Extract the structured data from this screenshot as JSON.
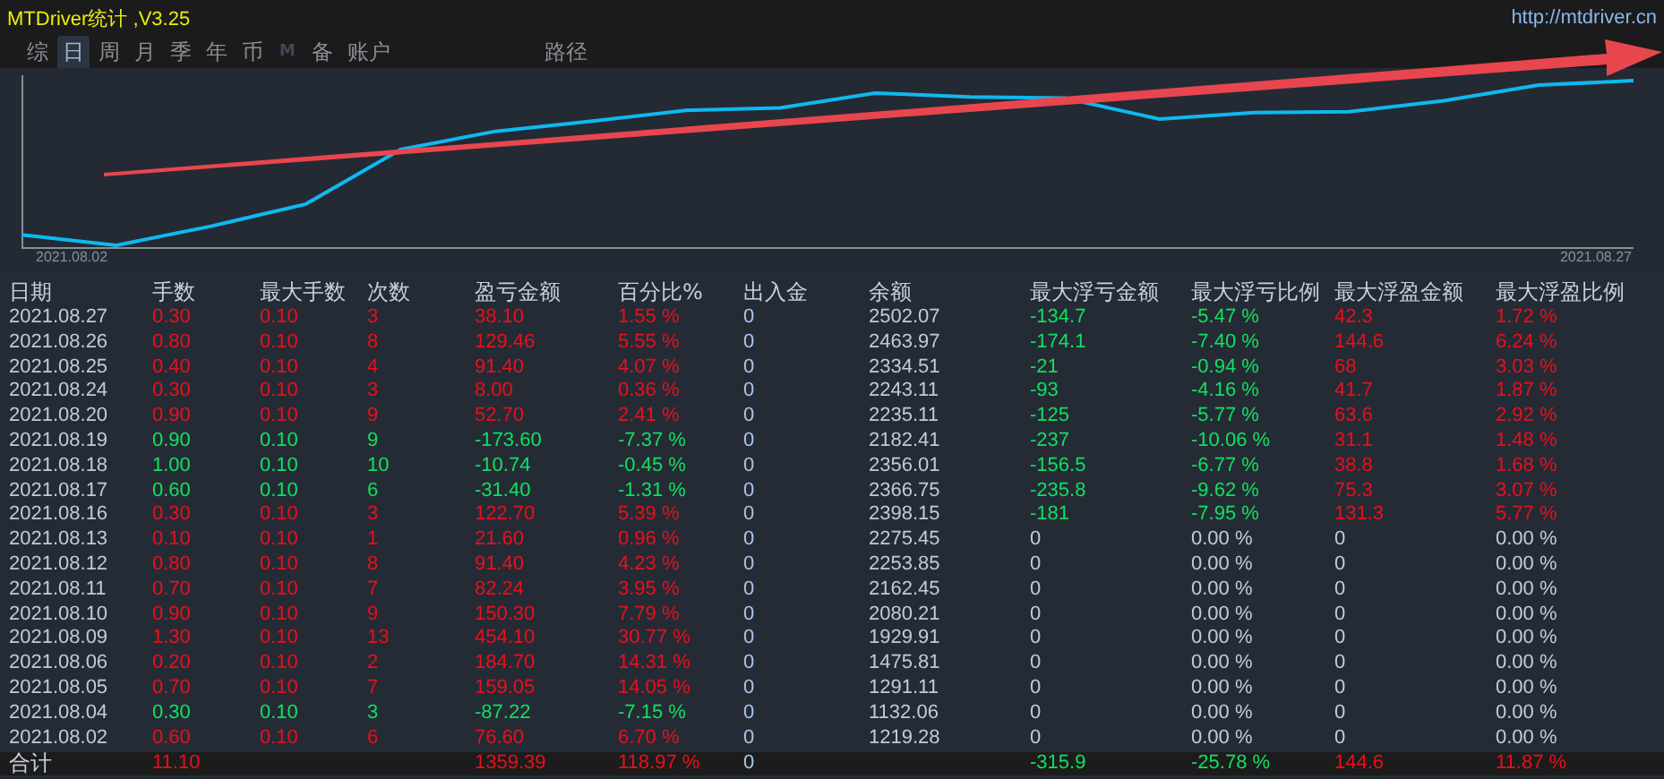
{
  "window": {
    "title": "MTDriver统计 ,V3.25",
    "url": "http://mtdriver.cn"
  },
  "tabs": [
    {
      "label": "综",
      "kind": "char",
      "selected": false
    },
    {
      "label": "日",
      "kind": "char",
      "selected": true
    },
    {
      "label": "周",
      "kind": "char",
      "selected": false
    },
    {
      "label": "月",
      "kind": "char",
      "selected": false
    },
    {
      "label": "季",
      "kind": "char",
      "selected": false
    },
    {
      "label": "年",
      "kind": "char",
      "selected": false
    },
    {
      "label": "币",
      "kind": "char",
      "selected": false
    },
    {
      "label": "M",
      "kind": "letter",
      "selected": false
    },
    {
      "label": "备",
      "kind": "char",
      "selected": false
    },
    {
      "label": "账户",
      "kind": "char",
      "selected": false
    }
  ],
  "path_tab": {
    "label": "路径",
    "selected": false
  },
  "chart": {
    "start_label": "2021.08.02",
    "end_label": "2021.08.27"
  },
  "table": {
    "columns": [
      "日期",
      "手数",
      "最大手数",
      "次数",
      "盈亏金额",
      "百分比%",
      "出入金",
      "余额",
      "最大浮亏金额",
      "最大浮亏比例",
      "最大浮盈金额",
      "最大浮盈比例"
    ],
    "rows": [
      {
        "kind": "gain",
        "float_recorded": true,
        "cells": [
          "2021.08.27",
          "0.30",
          "0.10",
          "3",
          "38.10",
          "1.55 %",
          "0",
          "2502.07",
          "-134.7",
          "-5.47 %",
          "42.3",
          "1.72 %"
        ]
      },
      {
        "kind": "gain",
        "float_recorded": true,
        "cells": [
          "2021.08.26",
          "0.80",
          "0.10",
          "8",
          "129.46",
          "5.55 %",
          "0",
          "2463.97",
          "-174.1",
          "-7.40 %",
          "144.6",
          "6.24 %"
        ]
      },
      {
        "kind": "gain",
        "float_recorded": true,
        "cells": [
          "2021.08.25",
          "0.40",
          "0.10",
          "4",
          "91.40",
          "4.07 %",
          "0",
          "2334.51",
          "-21",
          "-0.94 %",
          "68",
          "3.03 %"
        ]
      },
      {
        "kind": "gain",
        "float_recorded": true,
        "cells": [
          "2021.08.24",
          "0.30",
          "0.10",
          "3",
          "8.00",
          "0.36 %",
          "0",
          "2243.11",
          "-93",
          "-4.16 %",
          "41.7",
          "1.87 %"
        ]
      },
      {
        "kind": "gain",
        "float_recorded": true,
        "cells": [
          "2021.08.20",
          "0.90",
          "0.10",
          "9",
          "52.70",
          "2.41 %",
          "0",
          "2235.11",
          "-125",
          "-5.77 %",
          "63.6",
          "2.92 %"
        ]
      },
      {
        "kind": "loss",
        "float_recorded": true,
        "cells": [
          "2021.08.19",
          "0.90",
          "0.10",
          "9",
          "-173.60",
          "-7.37 %",
          "0",
          "2182.41",
          "-237",
          "-10.06 %",
          "31.1",
          "1.48 %"
        ]
      },
      {
        "kind": "loss",
        "float_recorded": true,
        "cells": [
          "2021.08.18",
          "1.00",
          "0.10",
          "10",
          "-10.74",
          "-0.45 %",
          "0",
          "2356.01",
          "-156.5",
          "-6.77 %",
          "38.8",
          "1.68 %"
        ]
      },
      {
        "kind": "loss",
        "float_recorded": true,
        "cells": [
          "2021.08.17",
          "0.60",
          "0.10",
          "6",
          "-31.40",
          "-1.31 %",
          "0",
          "2366.75",
          "-235.8",
          "-9.62 %",
          "75.3",
          "3.07 %"
        ]
      },
      {
        "kind": "gain",
        "float_recorded": true,
        "cells": [
          "2021.08.16",
          "0.30",
          "0.10",
          "3",
          "122.70",
          "5.39 %",
          "0",
          "2398.15",
          "-181",
          "-7.95 %",
          "131.3",
          "5.77 %"
        ]
      },
      {
        "kind": "gain",
        "float_recorded": false,
        "cells": [
          "2021.08.13",
          "0.10",
          "0.10",
          "1",
          "21.60",
          "0.96 %",
          "0",
          "2275.45",
          "0",
          "0.00 %",
          "0",
          "0.00 %"
        ]
      },
      {
        "kind": "gain",
        "float_recorded": false,
        "cells": [
          "2021.08.12",
          "0.80",
          "0.10",
          "8",
          "91.40",
          "4.23 %",
          "0",
          "2253.85",
          "0",
          "0.00 %",
          "0",
          "0.00 %"
        ]
      },
      {
        "kind": "gain",
        "float_recorded": false,
        "cells": [
          "2021.08.11",
          "0.70",
          "0.10",
          "7",
          "82.24",
          "3.95 %",
          "0",
          "2162.45",
          "0",
          "0.00 %",
          "0",
          "0.00 %"
        ]
      },
      {
        "kind": "gain",
        "float_recorded": false,
        "cells": [
          "2021.08.10",
          "0.90",
          "0.10",
          "9",
          "150.30",
          "7.79 %",
          "0",
          "2080.21",
          "0",
          "0.00 %",
          "0",
          "0.00 %"
        ]
      },
      {
        "kind": "gain",
        "float_recorded": false,
        "cells": [
          "2021.08.09",
          "1.30",
          "0.10",
          "13",
          "454.10",
          "30.77 %",
          "0",
          "1929.91",
          "0",
          "0.00 %",
          "0",
          "0.00 %"
        ]
      },
      {
        "kind": "gain",
        "float_recorded": false,
        "cells": [
          "2021.08.06",
          "0.20",
          "0.10",
          "2",
          "184.70",
          "14.31 %",
          "0",
          "1475.81",
          "0",
          "0.00 %",
          "0",
          "0.00 %"
        ]
      },
      {
        "kind": "gain",
        "float_recorded": false,
        "cells": [
          "2021.08.05",
          "0.70",
          "0.10",
          "7",
          "159.05",
          "14.05 %",
          "0",
          "1291.11",
          "0",
          "0.00 %",
          "0",
          "0.00 %"
        ]
      },
      {
        "kind": "loss",
        "float_recorded": false,
        "cells": [
          "2021.08.04",
          "0.30",
          "0.10",
          "3",
          "-87.22",
          "-7.15 %",
          "0",
          "1132.06",
          "0",
          "0.00 %",
          "0",
          "0.00 %"
        ]
      },
      {
        "kind": "gain",
        "float_recorded": false,
        "cells": [
          "2021.08.02",
          "0.60",
          "0.10",
          "6",
          "76.60",
          "6.70 %",
          "0",
          "1219.28",
          "0",
          "0.00 %",
          "0",
          "0.00 %"
        ]
      }
    ],
    "total": {
      "label": "合计",
      "lots": "11.10",
      "pnl": "1359.39",
      "percent": "118.97 %",
      "deposit": "0",
      "max_float_loss": "-315.9",
      "max_float_loss_pct": "-25.78 %",
      "max_float_profit": "144.6",
      "max_float_profit_pct": "11.87 %"
    }
  }
}
